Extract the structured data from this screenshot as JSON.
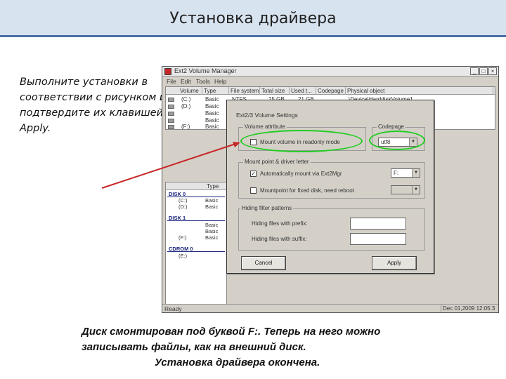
{
  "slide": {
    "title": "Установка драйвера",
    "instructions": "Выполните установки в соответствии с рисунком и подтвердите их клавишей Apply.",
    "caption_line1": "Диск смонтирован под буквой F:. Теперь на него можно",
    "caption_line2": "записывать файлы, как на внешний диск.",
    "caption_line3": "Установка   драйвера окончена."
  },
  "window": {
    "title": "Ext2 Volume Manager",
    "menu": [
      "File",
      "Edit",
      "Tools",
      "Help"
    ],
    "columns": [
      "Volume",
      "Type",
      "File system",
      "Total size",
      "Used t...",
      "Codepage",
      "Physical object"
    ],
    "rows": [
      {
        "volume": "(C:)",
        "type": "Basic",
        "fs": "NTFS",
        "total": "25 GB",
        "used": "21 GB",
        "codepage": "",
        "physical": "\\Device\\HarddiskVolume1"
      },
      {
        "volume": "(D:)",
        "type": "Basic",
        "fs": "",
        "total": "",
        "used": "",
        "codepage": "",
        "physical": ""
      },
      {
        "volume": "",
        "type": "Basic",
        "fs": "",
        "total": "",
        "used": "",
        "codepage": "",
        "physical": ""
      },
      {
        "volume": "",
        "type": "Basic",
        "fs": "",
        "total": "",
        "used": "",
        "codepage": "",
        "physical": ""
      },
      {
        "volume": "(F:)",
        "type": "Basic",
        "fs": "",
        "total": "",
        "used": "",
        "codepage": "",
        "physical": ""
      }
    ],
    "disk_panel": {
      "type_header": "Type",
      "disk0": "DISK 0",
      "disk0_rows": [
        {
          "vol": "(C:)",
          "type": "Basic"
        },
        {
          "vol": "(D:)",
          "type": "Basic"
        }
      ],
      "disk1": "DISK 1",
      "disk1_rows": [
        {
          "vol": "",
          "type": "Basic"
        },
        {
          "vol": "",
          "type": "Basic"
        },
        {
          "vol": "(F:)",
          "type": "Basic"
        }
      ],
      "cdrom": "CDROM 0",
      "cdrom_rows": [
        {
          "vol": "(E:)",
          "type": ""
        }
      ]
    },
    "status_left": "Ready",
    "status_right": "Dec 01,2009 12:05:3"
  },
  "dialog": {
    "title": "Ext2/3 Volume Settings",
    "volume_attribute": {
      "label": "Volume attribute",
      "readonly_label": "Mount volume in readonly mode",
      "readonly_checked": false
    },
    "codepage": {
      "label": "Codepage",
      "value": "utf8"
    },
    "mount_point": {
      "label": "Mount point & driver letter",
      "auto_mount_label": "Automatically mount via Ext2Mgr",
      "auto_mount_checked": true,
      "drive_value": "F:",
      "mountpoint_label": "Mountpoint for fixed disk, need reboot",
      "mountpoint_checked": false,
      "mountpoint_value": ""
    },
    "hiding": {
      "label": "Hiding filter patterns",
      "prefix_label": "Hiding files with prefix:",
      "prefix_value": "",
      "suffix_label": "Hiding files with suffix:",
      "suffix_value": ""
    },
    "cancel_label": "Cancel",
    "apply_label": "Apply"
  },
  "colors": {
    "highlight_oval": "#22cc22",
    "pointer_arrow": "#c62828",
    "header_band": "#d8e3f0"
  }
}
